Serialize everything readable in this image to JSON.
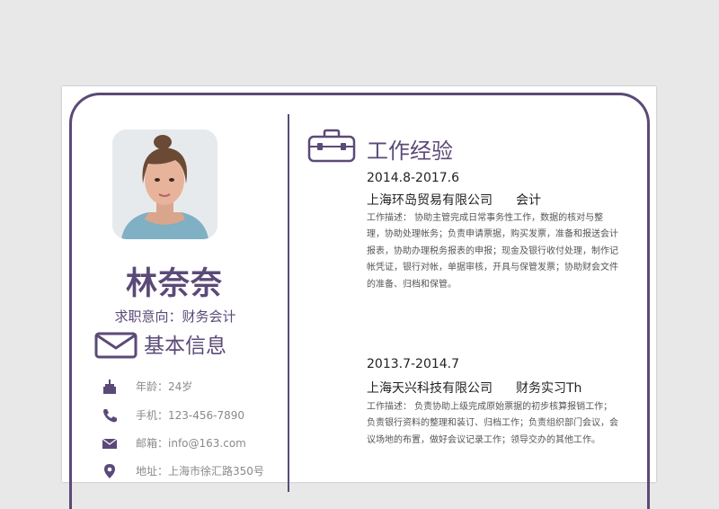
{
  "profile": {
    "name": "林奈奈",
    "intent": "求职意向：财务会计"
  },
  "basic_info": {
    "title": "基本信息",
    "items": [
      {
        "icon": "cake-icon",
        "text": "年龄：24岁"
      },
      {
        "icon": "phone-icon",
        "text": "手机：123-456-7890"
      },
      {
        "icon": "mail-icon",
        "text": "邮箱：info@163.com"
      },
      {
        "icon": "location-icon",
        "text": "地址：上海市徐汇路350号"
      }
    ]
  },
  "work": {
    "title": "工作经验",
    "jobs": [
      {
        "date": "2014.8-2017.6",
        "company": "上海环岛贸易有限公司",
        "role": "会计",
        "desc": "工作描述： 协助主管完成日常事务性工作，数据的核对与整理，协助处理帐务；负责申请票据，购买发票，准备和报送会计报表，协助办理税务报表的申报；现金及银行收付处理，制作记帐凭证，银行对帐，单据审核，开具与保管发票；协助财会文件的准备、归档和保管。"
      },
      {
        "date": "2013.7-2014.7",
        "company": "上海天兴科技有限公司",
        "role": "财务实习Th",
        "desc": "工作描述： 负责协助上级完成原始票据的初步核算报销工作；负责银行资料的整理和装订、归档工作；负责组织部门会议，会议场地的布置，做好会议记录工作；领导交办的其他工作。"
      }
    ]
  },
  "colors": {
    "accent": "#5b4a78",
    "background": "#e8e8e8",
    "paper": "#ffffff"
  }
}
